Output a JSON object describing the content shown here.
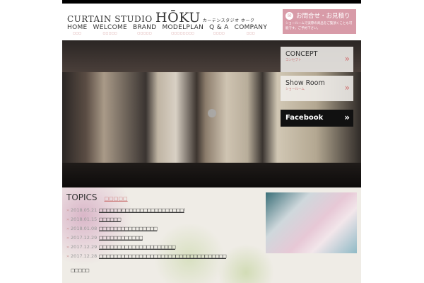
{
  "header": {
    "logo_main": "CURTAIN STUDIO ",
    "logo_big": "HŌKU",
    "logo_kana": "カーテンスタジオ ホーク",
    "nav": [
      {
        "label": "HOME",
        "sub": "□□□"
      },
      {
        "label": "WELCOME",
        "sub": "□□□□□"
      },
      {
        "label": "BRAND",
        "sub": "□□□□□"
      },
      {
        "label": "MODELPLAN",
        "sub": "□□□□□□□□"
      },
      {
        "label": "Q & A",
        "sub": "□□□□"
      },
      {
        "label": "COMPANY",
        "sub": "□□□"
      }
    ],
    "contact": {
      "title": "お問合せ・お見積り",
      "desc": "ショールームで実際の商品をご覧頂くことも可能です。ご予約下さい。"
    }
  },
  "hero": {
    "panels": [
      {
        "label": "CONCEPT",
        "sub": "コンセプト"
      },
      {
        "label": "Show Room",
        "sub": "ショールーム"
      }
    ],
    "facebook": "Facebook",
    "chevron": "»"
  },
  "topics": {
    "title": "TOPICS",
    "sub": "□□□□□",
    "items": [
      {
        "date": "2018.05.21",
        "text": "□□□□□□/□□□□□□□□□□□□□□□□□/"
      },
      {
        "date": "2018.01.15",
        "text": "□□□□□□"
      },
      {
        "date": "2018.01.08",
        "text": "□□□□□□□□□□□□□□□□"
      },
      {
        "date": "2017.12.29",
        "text": "□□□□□□□□□□□□"
      },
      {
        "date": "2017.12.29",
        "text": "□□□□□□□□□□□□□□□□□□□□□"
      },
      {
        "date": "2017.12.28",
        "text": "□□□□□□□□□□□□□□□□□□□□□□□□□□□□□□□□□□□"
      }
    ],
    "more": "□□□□□"
  }
}
